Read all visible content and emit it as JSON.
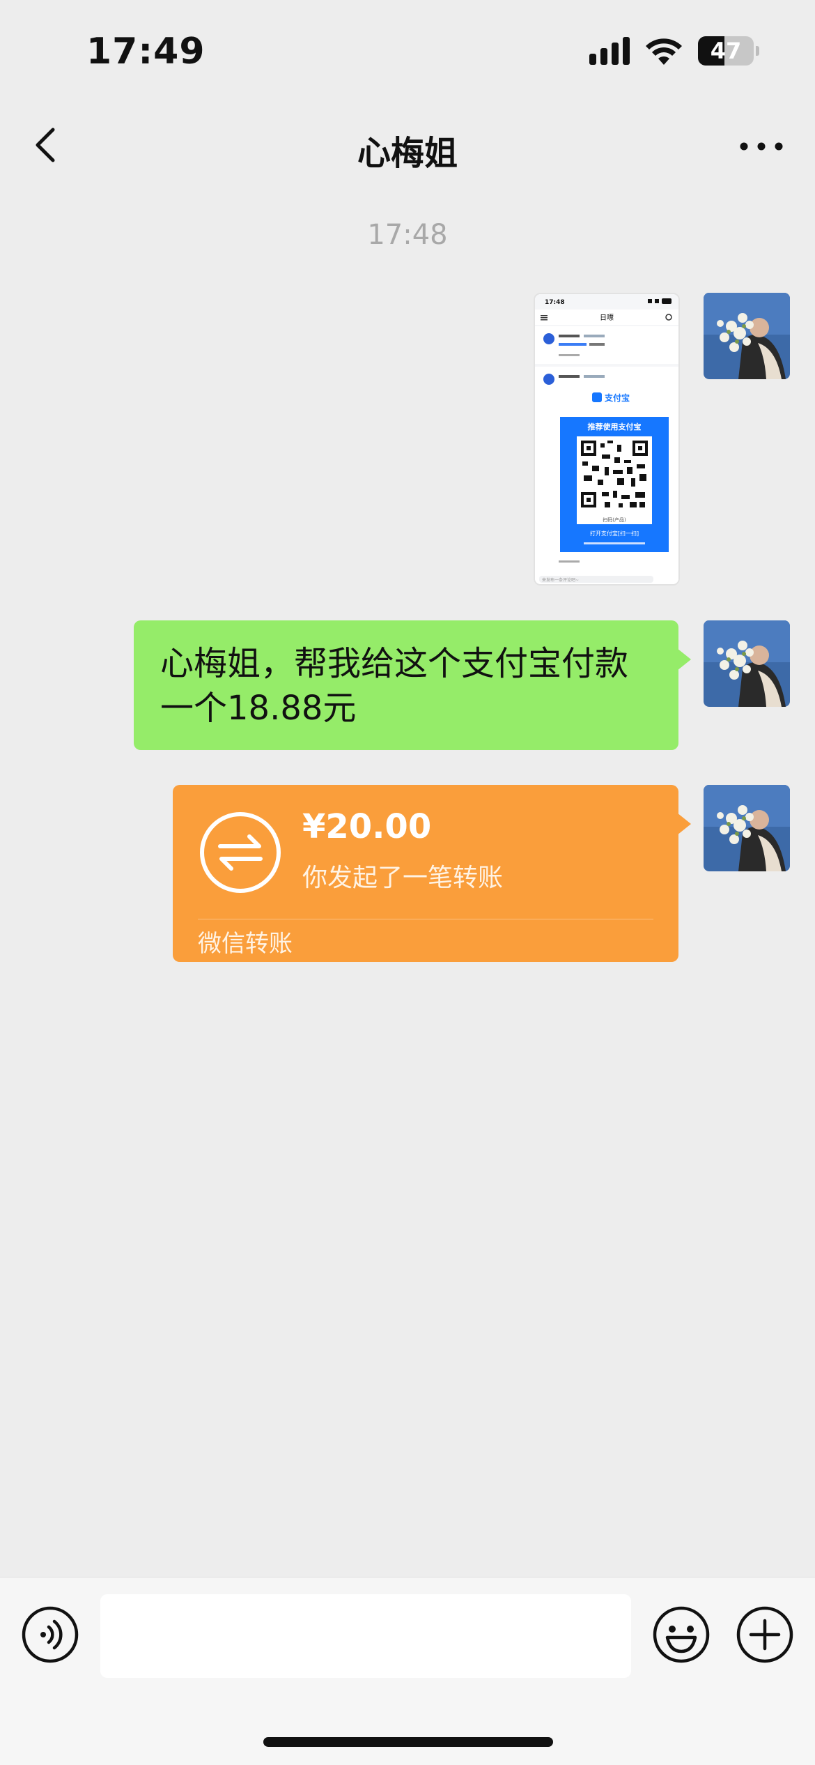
{
  "status_bar": {
    "time": "17:49",
    "battery": "47",
    "battery_level_percent": 47,
    "icons": [
      "cellular-signal-icon",
      "wifi-icon",
      "battery-icon"
    ]
  },
  "nav": {
    "title": "心梅姐",
    "back_icon": "chevron-left-icon",
    "more_icon": "more-dots-icon"
  },
  "chat": {
    "timestamp": "17:48",
    "messages": [
      {
        "type": "image",
        "content": "Screenshot of a post showing an Alipay QR code",
        "screenshot": {
          "time": "17:48",
          "title": "日嘌",
          "alipay_brand": "支付宝",
          "banner": "推荐使用支付宝",
          "qr_caption": "扫码(产品)",
          "open_hint": "打开支付宝[扫一扫]",
          "comment_placeholder": "来发布一条评论吧~"
        }
      },
      {
        "type": "text",
        "text": "心梅姐，帮我给这个支付宝付款一个18.88元"
      },
      {
        "type": "transfer",
        "amount": "¥20.00",
        "description": "你发起了一笔转账",
        "footer": "微信转账"
      }
    ]
  },
  "input_bar": {
    "voice_icon": "voice-icon",
    "emoji_icon": "emoji-icon",
    "plus_icon": "plus-icon",
    "input_value": ""
  },
  "colors": {
    "background": "#ededed",
    "bubble_green": "#95ec69",
    "transfer_orange": "#fa9e3b",
    "alipay_blue": "#1677ff"
  }
}
